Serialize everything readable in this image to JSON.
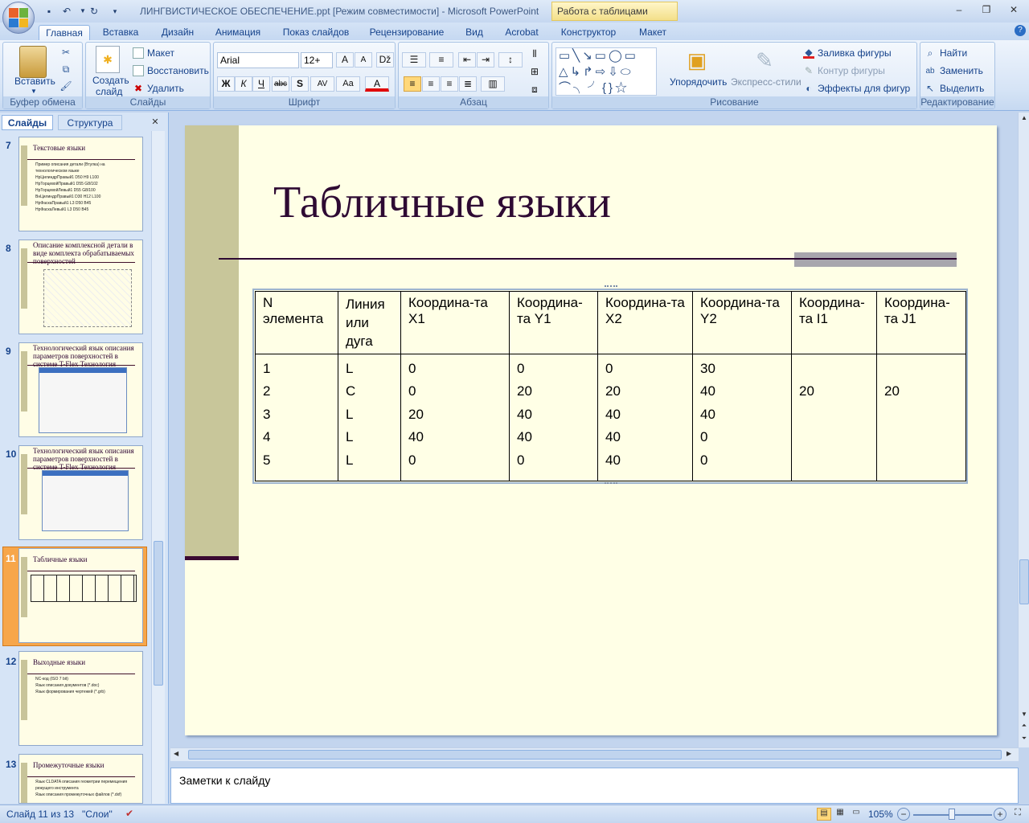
{
  "window": {
    "title": "ЛИНГВИСТИЧЕСКОЕ ОБЕСПЕЧЕНИЕ.ppt [Режим совместимости] - Microsoft PowerPoint",
    "context_tab": "Работа с таблицами"
  },
  "ribbon_tabs": [
    "Главная",
    "Вставка",
    "Дизайн",
    "Анимация",
    "Показ слайдов",
    "Рецензирование",
    "Вид",
    "Acrobat",
    "Конструктор",
    "Макет"
  ],
  "ribbon": {
    "clipboard": {
      "paste": "Вставить",
      "label": "Буфер обмена"
    },
    "slides": {
      "new_slide_1": "Создать",
      "new_slide_2": "слайд",
      "layout": "Макет",
      "reset": "Восстановить",
      "delete": "Удалить",
      "label": "Слайды"
    },
    "font": {
      "name": "Arial",
      "size": "12+",
      "label": "Шрифт"
    },
    "paragraph": {
      "label": "Абзац"
    },
    "drawing": {
      "arrange": "Упорядочить",
      "quick_styles": "Экспресс-стили",
      "fill": "Заливка фигуры",
      "outline": "Контур фигуры",
      "effects": "Эффекты для фигур",
      "label": "Рисование"
    },
    "editing": {
      "find": "Найти",
      "replace": "Заменить",
      "select": "Выделить",
      "label": "Редактирование"
    }
  },
  "left_pane": {
    "tabs": [
      "Слайды",
      "Структура"
    ],
    "thumbnails": [
      {
        "num": "7",
        "title": "Текстовые языки",
        "bullets": [
          "Пример описания детали (Втулка) на технологическом языке",
          "НрЦилиндрПравый1 D50 H9 L100",
          "НрТорцевойПравый1 D55 G8/102",
          "НрТорцевойЛевый1 D55 G8/100",
          "ВнЦилиндрПравый1 D30 H12 L100",
          "НрФаскаПравый1 L3 D50 B45",
          "НрФаскаЛевый1 L3 D50 B45"
        ]
      },
      {
        "num": "8",
        "title": "Описание комплексной детали в виде комплекта обрабатываемых поверхностей",
        "bullets": []
      },
      {
        "num": "9",
        "title": "Технологический язык описания параметров поверхностей в системе T-Flex Технология",
        "bullets": []
      },
      {
        "num": "10",
        "title": "Технологический язык описания параметров поверхностей в системе T-Flex Технология",
        "bullets": []
      },
      {
        "num": "11",
        "title": "Табличные языки",
        "bullets": []
      },
      {
        "num": "12",
        "title": "Выходные языки",
        "bullets": [
          "NC-код (ISO 7 bit)",
          "Язык описания документов (*.doc)",
          "Язык формирования чертежей (*.grb)"
        ]
      },
      {
        "num": "13",
        "title": "Промежуточные языки",
        "bullets": [
          "Язык CLDATA описания геометрии перемещения режущего инструмента",
          "Язык описания промежуточных файлов (*.dxf)"
        ]
      }
    ]
  },
  "slide": {
    "title": "Табличные языки",
    "table": {
      "headers": [
        "N элемента",
        "Линия или дуга",
        "Координа-та X1",
        "Координа-та Y1",
        "Координа-та X2",
        "Координа-та Y2",
        "Координа-та I1",
        "Координа-та J1"
      ],
      "columns": [
        [
          "1",
          "2",
          "3",
          "4",
          "5"
        ],
        [
          "L",
          "C",
          "L",
          "L",
          "L"
        ],
        [
          "0",
          "0",
          "20",
          "40",
          "0"
        ],
        [
          "0",
          "20",
          "40",
          "40",
          "0"
        ],
        [
          "0",
          "20",
          "40",
          "40",
          "40"
        ],
        [
          "30",
          "40",
          "40",
          "0",
          "0"
        ],
        [
          "",
          "20",
          "",
          "",
          ""
        ],
        [
          "",
          "20",
          "",
          "",
          ""
        ]
      ]
    }
  },
  "notes_placeholder": "Заметки к слайду",
  "status": {
    "slide_info": "Слайд 11 из 13",
    "theme": "\"Слои\"",
    "zoom": "105%"
  },
  "colors": {
    "slide_bg": "#ffffe6",
    "accent_bar": "#c8c69a",
    "title_color": "#2e0a33",
    "ribbon_bg": "#d6e4f6"
  }
}
